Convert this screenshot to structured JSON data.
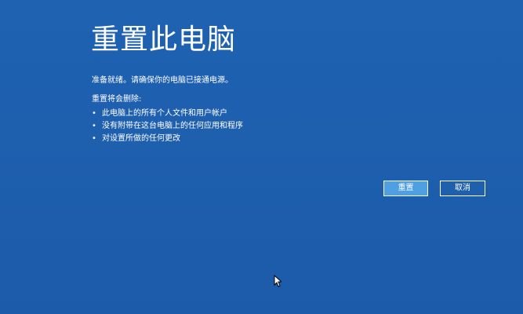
{
  "window": {
    "title": "重置此电脑"
  },
  "message": {
    "ready": "准备就绪。请确保你的电脑已接通电源。"
  },
  "remove_section": {
    "heading": "重置将会删除:",
    "items": [
      {
        "bullet": "•",
        "text": "此电脑上的所有个人文件和用户帐户"
      },
      {
        "bullet": "•",
        "text": "没有附带在这台电脑上的任何应用和程序"
      },
      {
        "bullet": "•",
        "text": "对设置所做的任何更改"
      }
    ]
  },
  "buttons": {
    "reset_label": "重置",
    "cancel_label": "取消"
  },
  "colors": {
    "background": "#1e5fae",
    "reset_button_fill": "#4f9fe3",
    "text": "#ffffff"
  },
  "icons": {
    "cursor": "mouse-pointer-icon"
  }
}
